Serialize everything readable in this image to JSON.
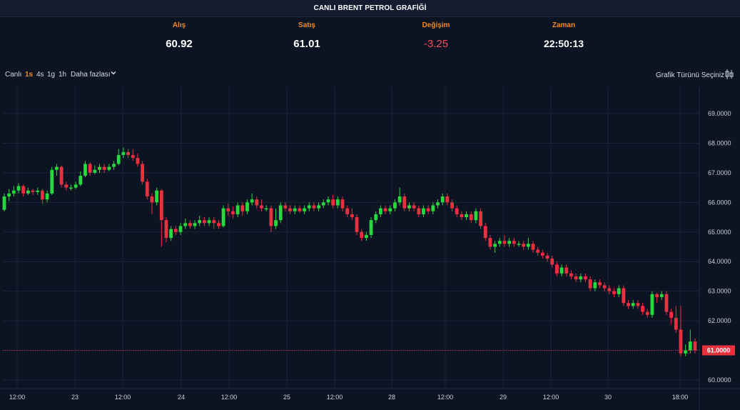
{
  "header": {
    "title": "CANLI BRENT PETROL GRAFİĞİ"
  },
  "quotes": {
    "bid": {
      "label": "Alış",
      "value": "60.92"
    },
    "ask": {
      "label": "Satış",
      "value": "61.01"
    },
    "change": {
      "label": "Değişim",
      "value": "-3.25"
    },
    "time": {
      "label": "Zaman",
      "value": "22:50:13"
    }
  },
  "toolbar": {
    "live": "Canlı",
    "timeframes": [
      "1s",
      "4s",
      "1g",
      "1h"
    ],
    "active_timeframe": "1s",
    "more": "Daha fazlası",
    "chart_type": "Grafik Türünü Seçiniz"
  },
  "colors": {
    "background": "#0c1424",
    "up": "#26d93d",
    "down": "#e8313f",
    "accent": "#f08a24",
    "grid": "#1a2436",
    "price_line": "#e8313f"
  },
  "chart_data": {
    "type": "candlestick",
    "ylim": [
      59.8,
      69.5
    ],
    "y_ticks": [
      "69.0000",
      "68.0000",
      "67.0000",
      "66.0000",
      "65.0000",
      "64.0000",
      "63.0000",
      "62.0000",
      "61.0000",
      "60.0000"
    ],
    "y_tick_values": [
      69,
      68,
      67,
      66,
      65,
      64,
      63,
      62,
      61,
      60
    ],
    "x_tick_labels": [
      "12:00",
      "23",
      "12:00",
      "24",
      "12:00",
      "25",
      "12:00",
      "28",
      "12:00",
      "29",
      "12:00",
      "30",
      "18:00"
    ],
    "last_price": 61.0,
    "last_price_label": "61.0000",
    "candles": [
      [
        65.75,
        66.2,
        66.3,
        65.7
      ],
      [
        66.2,
        66.3,
        66.45,
        66.05
      ],
      [
        66.3,
        66.4,
        66.55,
        66.2
      ],
      [
        66.4,
        66.55,
        66.65,
        66.3
      ],
      [
        66.55,
        66.3,
        66.6,
        66.2
      ],
      [
        66.3,
        66.4,
        66.5,
        66.25
      ],
      [
        66.4,
        66.35,
        66.45,
        66.25
      ],
      [
        66.35,
        66.4,
        66.5,
        66.25
      ],
      [
        66.4,
        66.1,
        66.45,
        65.95
      ],
      [
        66.1,
        66.3,
        66.4,
        66.0
      ],
      [
        66.3,
        67.1,
        67.2,
        66.25
      ],
      [
        67.1,
        67.2,
        67.3,
        66.9
      ],
      [
        67.2,
        66.6,
        67.25,
        66.5
      ],
      [
        66.6,
        66.5,
        66.7,
        66.4
      ],
      [
        66.5,
        66.5,
        66.6,
        66.4
      ],
      [
        66.5,
        66.6,
        66.7,
        66.45
      ],
      [
        66.6,
        66.9,
        67.05,
        66.55
      ],
      [
        66.9,
        67.3,
        67.4,
        66.85
      ],
      [
        67.3,
        67.0,
        67.35,
        66.9
      ],
      [
        67.0,
        67.1,
        67.25,
        66.95
      ],
      [
        67.1,
        67.2,
        67.3,
        67.0
      ],
      [
        67.2,
        67.1,
        67.3,
        67.0
      ],
      [
        67.1,
        67.2,
        67.3,
        67.05
      ],
      [
        67.2,
        67.3,
        67.4,
        67.1
      ],
      [
        67.3,
        67.6,
        67.8,
        67.25
      ],
      [
        67.6,
        67.7,
        67.85,
        67.5
      ],
      [
        67.7,
        67.6,
        67.8,
        67.5
      ],
      [
        67.6,
        67.5,
        67.8,
        67.4
      ],
      [
        67.5,
        67.3,
        67.65,
        67.2
      ],
      [
        67.3,
        66.7,
        67.4,
        66.6
      ],
      [
        66.7,
        66.2,
        66.8,
        66.1
      ],
      [
        66.2,
        66.0,
        66.3,
        65.6
      ],
      [
        66.0,
        66.4,
        66.5,
        65.9
      ],
      [
        66.4,
        65.4,
        66.45,
        64.5
      ],
      [
        65.4,
        64.8,
        65.5,
        64.65
      ],
      [
        64.8,
        65.1,
        65.2,
        64.7
      ],
      [
        65.1,
        65.0,
        65.2,
        64.9
      ],
      [
        65.0,
        65.2,
        65.3,
        64.9
      ],
      [
        65.2,
        65.3,
        65.45,
        65.1
      ],
      [
        65.3,
        65.2,
        65.4,
        65.1
      ],
      [
        65.2,
        65.3,
        65.4,
        65.1
      ],
      [
        65.3,
        65.4,
        65.55,
        65.2
      ],
      [
        65.4,
        65.3,
        65.5,
        65.2
      ],
      [
        65.3,
        65.4,
        65.5,
        65.2
      ],
      [
        65.4,
        65.3,
        65.5,
        65.1
      ],
      [
        65.3,
        65.2,
        65.4,
        65.1
      ],
      [
        65.2,
        65.8,
        65.9,
        65.15
      ],
      [
        65.8,
        65.7,
        65.95,
        65.55
      ],
      [
        65.7,
        65.6,
        65.85,
        65.45
      ],
      [
        65.6,
        65.9,
        66.0,
        65.5
      ],
      [
        65.9,
        65.7,
        66.0,
        65.55
      ],
      [
        65.7,
        66.0,
        66.1,
        65.6
      ],
      [
        66.0,
        66.1,
        66.3,
        65.9
      ],
      [
        66.1,
        65.9,
        66.2,
        65.8
      ],
      [
        65.9,
        65.8,
        66.1,
        65.7
      ],
      [
        65.8,
        65.8,
        65.9,
        65.7
      ],
      [
        65.8,
        65.2,
        65.9,
        65.0
      ],
      [
        65.2,
        65.4,
        65.8,
        65.1
      ],
      [
        65.4,
        65.9,
        66.0,
        65.3
      ],
      [
        65.9,
        65.8,
        66.0,
        65.7
      ],
      [
        65.8,
        65.7,
        65.9,
        65.6
      ],
      [
        65.7,
        65.8,
        65.9,
        65.6
      ],
      [
        65.8,
        65.7,
        65.9,
        65.65
      ],
      [
        65.7,
        65.8,
        65.9,
        65.6
      ],
      [
        65.8,
        65.9,
        66.0,
        65.7
      ],
      [
        65.9,
        65.8,
        66.0,
        65.7
      ],
      [
        65.8,
        65.9,
        66.0,
        65.7
      ],
      [
        65.9,
        66.0,
        66.1,
        65.8
      ],
      [
        66.0,
        66.1,
        66.2,
        65.9
      ],
      [
        66.1,
        65.9,
        66.25,
        65.8
      ],
      [
        65.9,
        66.1,
        66.2,
        65.8
      ],
      [
        66.1,
        65.8,
        66.2,
        65.7
      ],
      [
        65.8,
        65.6,
        65.9,
        65.5
      ],
      [
        65.6,
        65.5,
        65.8,
        65.4
      ],
      [
        65.5,
        65.0,
        65.6,
        64.9
      ],
      [
        65.0,
        64.8,
        65.1,
        64.7
      ],
      [
        64.8,
        64.9,
        65.0,
        64.7
      ],
      [
        64.9,
        65.4,
        65.5,
        64.8
      ],
      [
        65.4,
        65.6,
        65.7,
        65.3
      ],
      [
        65.6,
        65.8,
        65.9,
        65.5
      ],
      [
        65.8,
        65.7,
        65.9,
        65.6
      ],
      [
        65.7,
        65.8,
        65.9,
        65.6
      ],
      [
        65.8,
        66.0,
        66.1,
        65.7
      ],
      [
        66.0,
        66.2,
        66.5,
        65.9
      ],
      [
        66.2,
        65.8,
        66.3,
        65.7
      ],
      [
        65.8,
        65.9,
        66.0,
        65.7
      ],
      [
        65.9,
        65.8,
        66.0,
        65.7
      ],
      [
        65.8,
        65.6,
        65.9,
        65.5
      ],
      [
        65.6,
        65.8,
        65.9,
        65.5
      ],
      [
        65.8,
        65.7,
        65.9,
        65.6
      ],
      [
        65.7,
        65.9,
        66.0,
        65.6
      ],
      [
        65.9,
        66.0,
        66.1,
        65.8
      ],
      [
        66.0,
        66.2,
        66.3,
        65.9
      ],
      [
        66.2,
        66.0,
        66.3,
        65.9
      ],
      [
        66.0,
        65.8,
        66.1,
        65.7
      ],
      [
        65.8,
        65.6,
        65.9,
        65.5
      ],
      [
        65.6,
        65.5,
        65.7,
        65.4
      ],
      [
        65.5,
        65.6,
        65.7,
        65.4
      ],
      [
        65.6,
        65.4,
        65.7,
        65.3
      ],
      [
        65.4,
        65.7,
        65.8,
        65.3
      ],
      [
        65.7,
        65.2,
        65.8,
        65.1
      ],
      [
        65.2,
        64.8,
        65.3,
        64.7
      ],
      [
        64.8,
        64.5,
        64.9,
        64.4
      ],
      [
        64.5,
        64.6,
        64.7,
        64.3
      ],
      [
        64.6,
        64.7,
        64.8,
        64.5
      ],
      [
        64.7,
        64.6,
        64.9,
        64.5
      ],
      [
        64.6,
        64.7,
        64.8,
        64.5
      ],
      [
        64.7,
        64.6,
        64.8,
        64.5
      ],
      [
        64.6,
        64.6,
        64.7,
        64.5
      ],
      [
        64.6,
        64.5,
        64.7,
        64.4
      ],
      [
        64.5,
        64.6,
        64.8,
        64.4
      ],
      [
        64.6,
        64.4,
        64.7,
        64.3
      ],
      [
        64.4,
        64.3,
        64.5,
        64.2
      ],
      [
        64.3,
        64.2,
        64.4,
        64.1
      ],
      [
        64.2,
        64.1,
        64.3,
        64.0
      ],
      [
        64.1,
        63.9,
        64.2,
        63.8
      ],
      [
        63.9,
        63.6,
        64.0,
        63.5
      ],
      [
        63.6,
        63.8,
        63.9,
        63.5
      ],
      [
        63.8,
        63.6,
        63.9,
        63.5
      ],
      [
        63.6,
        63.5,
        63.7,
        63.4
      ],
      [
        63.5,
        63.4,
        63.6,
        63.3
      ],
      [
        63.4,
        63.5,
        63.6,
        63.3
      ],
      [
        63.5,
        63.4,
        63.6,
        63.3
      ],
      [
        63.4,
        63.1,
        63.5,
        63.0
      ],
      [
        63.1,
        63.3,
        63.4,
        63.0
      ],
      [
        63.3,
        63.2,
        63.4,
        63.1
      ],
      [
        63.2,
        63.1,
        63.3,
        63.0
      ],
      [
        63.1,
        63.0,
        63.2,
        62.9
      ],
      [
        63.0,
        62.9,
        63.1,
        62.8
      ],
      [
        62.9,
        63.1,
        63.2,
        62.8
      ],
      [
        63.1,
        62.6,
        63.2,
        62.5
      ],
      [
        62.6,
        62.5,
        62.7,
        62.4
      ],
      [
        62.5,
        62.6,
        62.7,
        62.4
      ],
      [
        62.6,
        62.5,
        62.7,
        62.4
      ],
      [
        62.5,
        62.3,
        62.6,
        62.2
      ],
      [
        62.3,
        62.2,
        62.4,
        62.1
      ],
      [
        62.2,
        62.9,
        63.0,
        62.1
      ],
      [
        62.9,
        62.8,
        62.95,
        62.6
      ],
      [
        62.8,
        62.9,
        63.0,
        62.7
      ],
      [
        62.9,
        62.3,
        63.0,
        62.2
      ],
      [
        62.3,
        62.1,
        62.4,
        61.9
      ],
      [
        62.1,
        61.7,
        62.5,
        61.6
      ],
      [
        61.7,
        60.9,
        62.5,
        60.8
      ],
      [
        60.9,
        61.0,
        61.2,
        60.8
      ],
      [
        61.0,
        61.3,
        61.7,
        60.9
      ],
      [
        61.3,
        61.0,
        61.4,
        60.9
      ]
    ]
  }
}
